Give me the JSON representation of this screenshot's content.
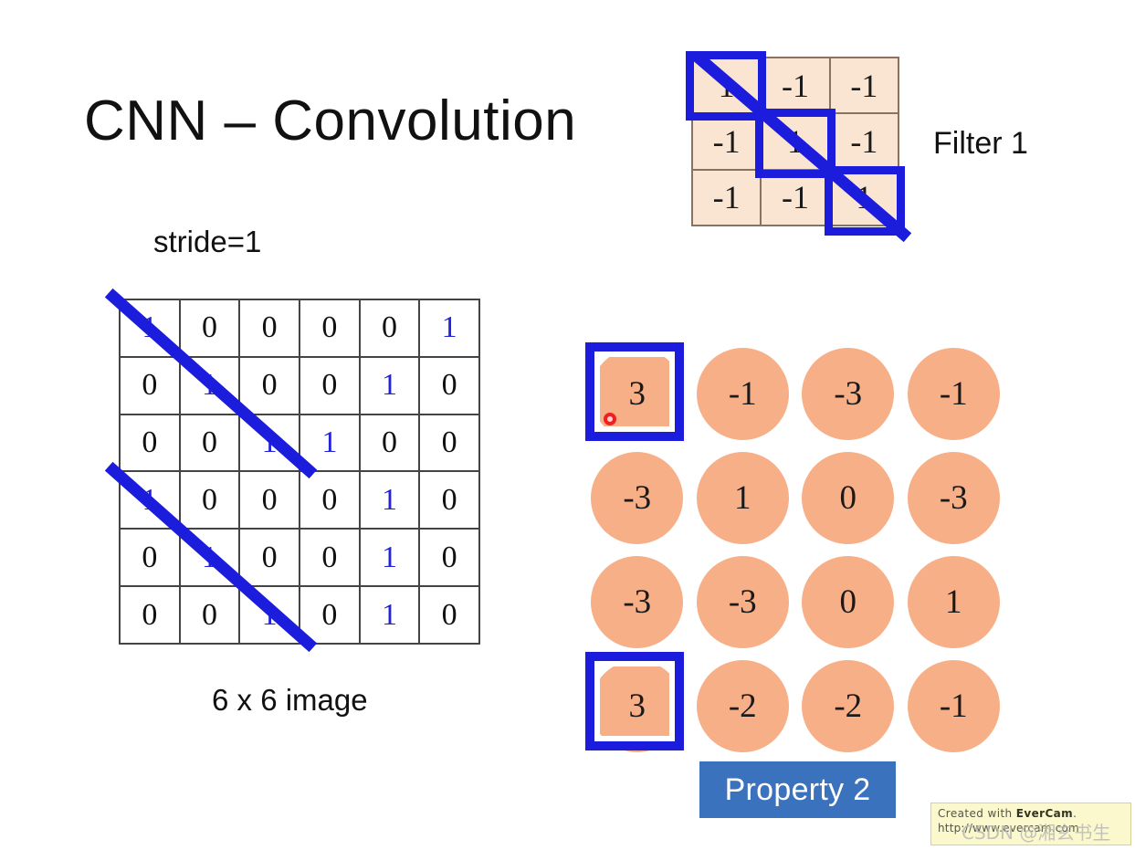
{
  "slide": {
    "title": "CNN – Convolution",
    "stride_label": "stride=1",
    "image_caption": "6 x 6 image",
    "filter_label": "Filter 1",
    "property_tag": "Property 2"
  },
  "colors": {
    "highlight_blue": "#1c1cdc",
    "property_blue": "#3a72bd",
    "filter_cell_bg": "#fae5d3",
    "feature_circle": "#f7af87",
    "one_digit_blue": "#2323d8",
    "pointer_red": "#f02020",
    "badge_yellow": "#fbf8cd"
  },
  "chart_data": {
    "type": "table",
    "title": "CNN – Convolution",
    "image_matrix": {
      "name": "6 x 6 image",
      "rows": 6,
      "cols": 6,
      "values": [
        [
          1,
          0,
          0,
          0,
          0,
          1
        ],
        [
          0,
          1,
          0,
          0,
          1,
          0
        ],
        [
          0,
          0,
          1,
          1,
          0,
          0
        ],
        [
          1,
          0,
          0,
          0,
          1,
          0
        ],
        [
          0,
          1,
          0,
          0,
          1,
          0
        ],
        [
          0,
          0,
          1,
          0,
          1,
          0
        ]
      ],
      "blue_digit_cells": [
        [
          0,
          0
        ],
        [
          0,
          5
        ],
        [
          1,
          1
        ],
        [
          1,
          4
        ],
        [
          2,
          2
        ],
        [
          2,
          3
        ],
        [
          3,
          0
        ],
        [
          3,
          4
        ],
        [
          4,
          1
        ],
        [
          4,
          4
        ],
        [
          5,
          2
        ],
        [
          5,
          4
        ]
      ],
      "diagonal_strokes": [
        {
          "from": [
            0,
            0
          ],
          "to": [
            2,
            2
          ]
        },
        {
          "from": [
            3,
            0
          ],
          "to": [
            5,
            2
          ]
        }
      ]
    },
    "filter": {
      "name": "Filter 1",
      "rows": 3,
      "cols": 3,
      "values": [
        [
          1,
          -1,
          -1
        ],
        [
          -1,
          1,
          -1
        ],
        [
          -1,
          -1,
          1
        ]
      ],
      "highlighted_cells": [
        [
          0,
          0
        ],
        [
          1,
          1
        ],
        [
          2,
          2
        ]
      ]
    },
    "feature_map": {
      "rows": 4,
      "cols": 4,
      "values": [
        [
          3,
          -1,
          -3,
          -1
        ],
        [
          -3,
          1,
          0,
          -3
        ],
        [
          -3,
          -3,
          0,
          1
        ],
        [
          3,
          -2,
          -2,
          -1
        ]
      ],
      "highlighted_cells": [
        [
          0,
          0
        ],
        [
          3,
          0
        ]
      ],
      "pointer_cell": [
        0,
        0
      ]
    },
    "stride": 1
  },
  "image_cells": [
    {
      "v": "1",
      "blue": true
    },
    {
      "v": "0",
      "blue": false
    },
    {
      "v": "0",
      "blue": false
    },
    {
      "v": "0",
      "blue": false
    },
    {
      "v": "0",
      "blue": false
    },
    {
      "v": "1",
      "blue": true
    },
    {
      "v": "0",
      "blue": false
    },
    {
      "v": "1",
      "blue": true
    },
    {
      "v": "0",
      "blue": false
    },
    {
      "v": "0",
      "blue": false
    },
    {
      "v": "1",
      "blue": true
    },
    {
      "v": "0",
      "blue": false
    },
    {
      "v": "0",
      "blue": false
    },
    {
      "v": "0",
      "blue": false
    },
    {
      "v": "1",
      "blue": true
    },
    {
      "v": "1",
      "blue": true
    },
    {
      "v": "0",
      "blue": false
    },
    {
      "v": "0",
      "blue": false
    },
    {
      "v": "1",
      "blue": true
    },
    {
      "v": "0",
      "blue": false
    },
    {
      "v": "0",
      "blue": false
    },
    {
      "v": "0",
      "blue": false
    },
    {
      "v": "1",
      "blue": true
    },
    {
      "v": "0",
      "blue": false
    },
    {
      "v": "0",
      "blue": false
    },
    {
      "v": "1",
      "blue": true
    },
    {
      "v": "0",
      "blue": false
    },
    {
      "v": "0",
      "blue": false
    },
    {
      "v": "1",
      "blue": true
    },
    {
      "v": "0",
      "blue": false
    },
    {
      "v": "0",
      "blue": false
    },
    {
      "v": "0",
      "blue": false
    },
    {
      "v": "1",
      "blue": true
    },
    {
      "v": "0",
      "blue": false
    },
    {
      "v": "1",
      "blue": true
    },
    {
      "v": "0",
      "blue": false
    }
  ],
  "filter_cells": [
    {
      "v": "1"
    },
    {
      "v": "-1"
    },
    {
      "v": "-1"
    },
    {
      "v": "-1"
    },
    {
      "v": "1"
    },
    {
      "v": "-1"
    },
    {
      "v": "-1"
    },
    {
      "v": "-1"
    },
    {
      "v": "1"
    }
  ],
  "feature_cells": [
    {
      "v": "3"
    },
    {
      "v": "-1"
    },
    {
      "v": "-3"
    },
    {
      "v": "-1"
    },
    {
      "v": "-3"
    },
    {
      "v": "1"
    },
    {
      "v": "0"
    },
    {
      "v": "-3"
    },
    {
      "v": "-3"
    },
    {
      "v": "-3"
    },
    {
      "v": "0"
    },
    {
      "v": "1"
    },
    {
      "v": "3"
    },
    {
      "v": "-2"
    },
    {
      "v": "-2"
    },
    {
      "v": "-1"
    }
  ],
  "badge": {
    "created_with": "Created with ",
    "brand": "EverCam",
    "period": ".",
    "url": "http://www.evercam.com",
    "watermark": "CSDN @湘玄书生"
  }
}
